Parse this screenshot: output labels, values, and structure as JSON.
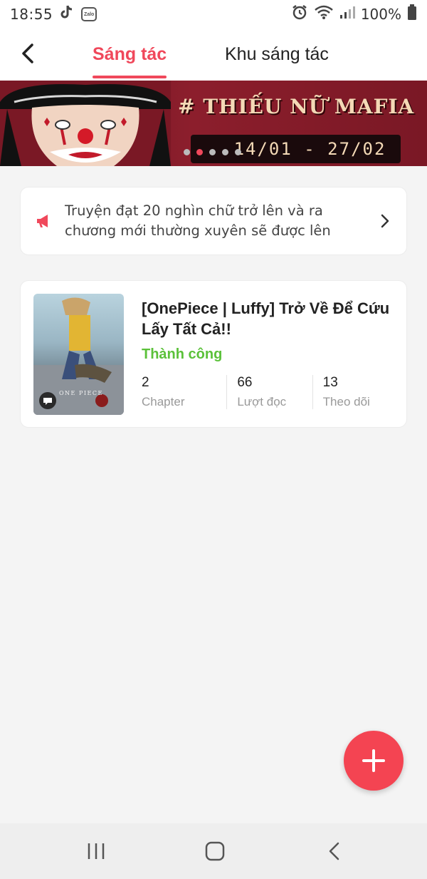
{
  "status_bar": {
    "time": "18:55",
    "zalo_label": "Zalo",
    "battery": "100%"
  },
  "header": {
    "tabs": [
      {
        "label": "Sáng tác",
        "active": true
      },
      {
        "label": "Khu sáng tác",
        "active": false
      }
    ]
  },
  "banner": {
    "title": "# THIẾU NỮ MAFIA",
    "date_range": "14/01 - 27/02",
    "slides": 5,
    "active_slide": 2
  },
  "notice": {
    "text": "Truyện đạt 20 nghìn chữ trở lên và ra chương mới thường xuyên sẽ được lên"
  },
  "story": {
    "title": "[OnePiece | Luffy] Trở Về Để Cứu Lấy Tất Cả!!",
    "status": "Thành công",
    "cover_caption": "ONE PIECE",
    "stats": [
      {
        "value": "2",
        "label": "Chapter"
      },
      {
        "value": "66",
        "label": "Lượt đọc"
      },
      {
        "value": "13",
        "label": "Theo dõi"
      }
    ]
  },
  "colors": {
    "accent": "#f0485b",
    "success": "#5bc13a",
    "fab": "#f44452"
  }
}
